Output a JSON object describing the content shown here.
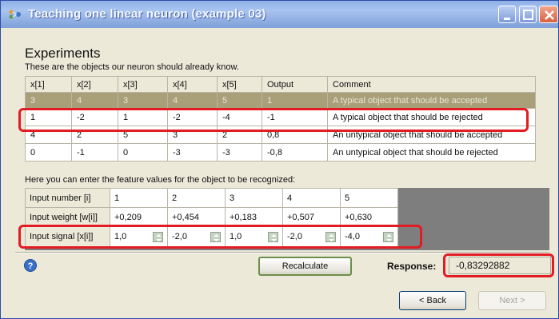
{
  "window": {
    "title": "Teaching one linear neuron (example 03)"
  },
  "experiments": {
    "heading": "Experiments",
    "subheading": "These are the objects our neuron should already know.",
    "columns": [
      "x[1]",
      "x[2]",
      "x[3]",
      "x[4]",
      "x[5]",
      "Output",
      "Comment"
    ],
    "rows": [
      [
        "3",
        "4",
        "3",
        "4",
        "5",
        "1",
        "A typical object that should be accepted"
      ],
      [
        "1",
        "-2",
        "1",
        "-2",
        "-4",
        "-1",
        "A typical object that should be rejected"
      ],
      [
        "4",
        "2",
        "5",
        "3",
        "2",
        "0,8",
        "An untypical object that should be accepted"
      ],
      [
        "0",
        "-1",
        "0",
        "-3",
        "-3",
        "-0,8",
        "An untypical object that should be rejected"
      ]
    ]
  },
  "recognition": {
    "hint": "Here you can enter the feature values for the object to be recognized:",
    "input_number_label": "Input number [i]",
    "input_numbers": [
      "1",
      "2",
      "3",
      "4",
      "5"
    ],
    "weight_label": "Input weight [w[i]]",
    "weights": [
      "+0,209",
      "+0,454",
      "+0,183",
      "+0,507",
      "+0,630"
    ],
    "signal_label": "Input signal [x[i]]",
    "signals": [
      "1,0",
      "-2,0",
      "1,0",
      "-2,0",
      "-4,0"
    ]
  },
  "actions": {
    "recalculate_label": "Recalculate",
    "response_label": "Response:",
    "response_value": "-0,83292882",
    "back_label": "< Back",
    "next_label": "Next >"
  },
  "icons": {
    "app": "neural-network-icon",
    "help": "help-icon",
    "minimize": "minimize-icon",
    "maximize": "maximize-icon",
    "close": "close-icon",
    "spin": "spin-arrows-icon"
  },
  "colors": {
    "highlight": "#e31b23",
    "selected_row": "#a9a07a",
    "dialog_bg": "#ece9d8"
  }
}
